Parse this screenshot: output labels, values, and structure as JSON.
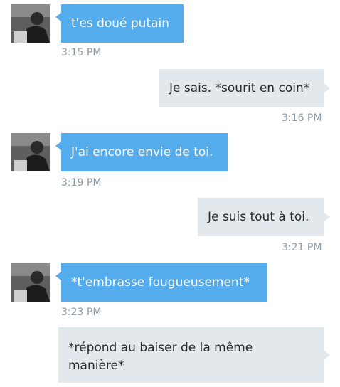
{
  "colors": {
    "incoming_bubble": "#55aced",
    "outgoing_bubble": "#e2e8ec",
    "timestamp": "#8b99a3"
  },
  "messages": [
    {
      "direction": "incoming",
      "text": "t'es doué putain",
      "time": "3:15 PM",
      "avatar": "avatar-photo"
    },
    {
      "direction": "outgoing",
      "text": "Je sais. *sourit en coin*",
      "time": "3:16 PM"
    },
    {
      "direction": "incoming",
      "text": "J'ai encore envie de toi.",
      "time": "3:19 PM",
      "avatar": "avatar-photo"
    },
    {
      "direction": "outgoing",
      "text": "Je suis tout à toi.",
      "time": "3:21 PM"
    },
    {
      "direction": "incoming",
      "text": "*t'embrasse fougueusement*",
      "time": "3:23 PM",
      "avatar": "avatar-photo"
    },
    {
      "direction": "outgoing",
      "text": "*répond au baiser de la même manière*"
    }
  ]
}
